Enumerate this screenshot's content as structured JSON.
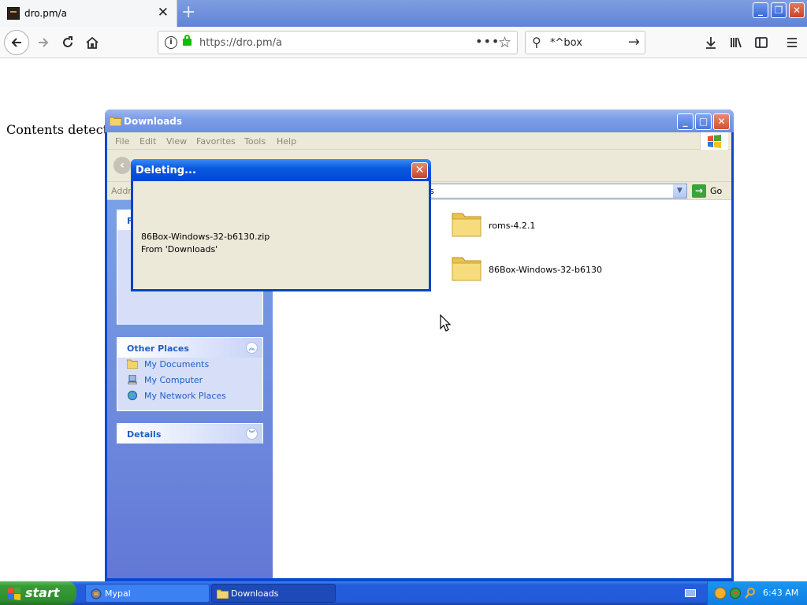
{
  "browser": {
    "tab_title": "dro.pm/a",
    "tab_close": "✕",
    "new_tab": "+",
    "url": "https://dro.pm/a",
    "search_query": "*^box",
    "window_buttons": [
      "_",
      "❐",
      "✕"
    ]
  },
  "page": {
    "text": "Contents detected"
  },
  "explorer": {
    "title": "Downloads",
    "menu": [
      "File",
      "Edit",
      "View",
      "Favorites",
      "Tools",
      "Help"
    ],
    "address_label": "Addr",
    "address_value": "s",
    "go_label": "Go",
    "sidebar": {
      "file_tasks_initial": "F",
      "other_places_title": "Other Places",
      "other_places_links": [
        "My Documents",
        "My Computer",
        "My Network Places"
      ],
      "details_title": "Details"
    },
    "files": [
      "roms-4.2.1",
      "86Box-Windows-32-b6130"
    ]
  },
  "dialog": {
    "title": "Deleting...",
    "file_name": "86Box-Windows-32-b6130.zip",
    "from_text": "From 'Downloads'"
  },
  "taskbar": {
    "start_label": "start",
    "tasks": [
      "Mypal",
      "Downloads"
    ],
    "active_task": "Downloads",
    "time": "6:43 AM"
  },
  "colors": {
    "xp_blue": "#0842c4",
    "xp_green": "#379b37",
    "link_blue": "#215dc6",
    "dialog_bg": "#ece9d8"
  }
}
